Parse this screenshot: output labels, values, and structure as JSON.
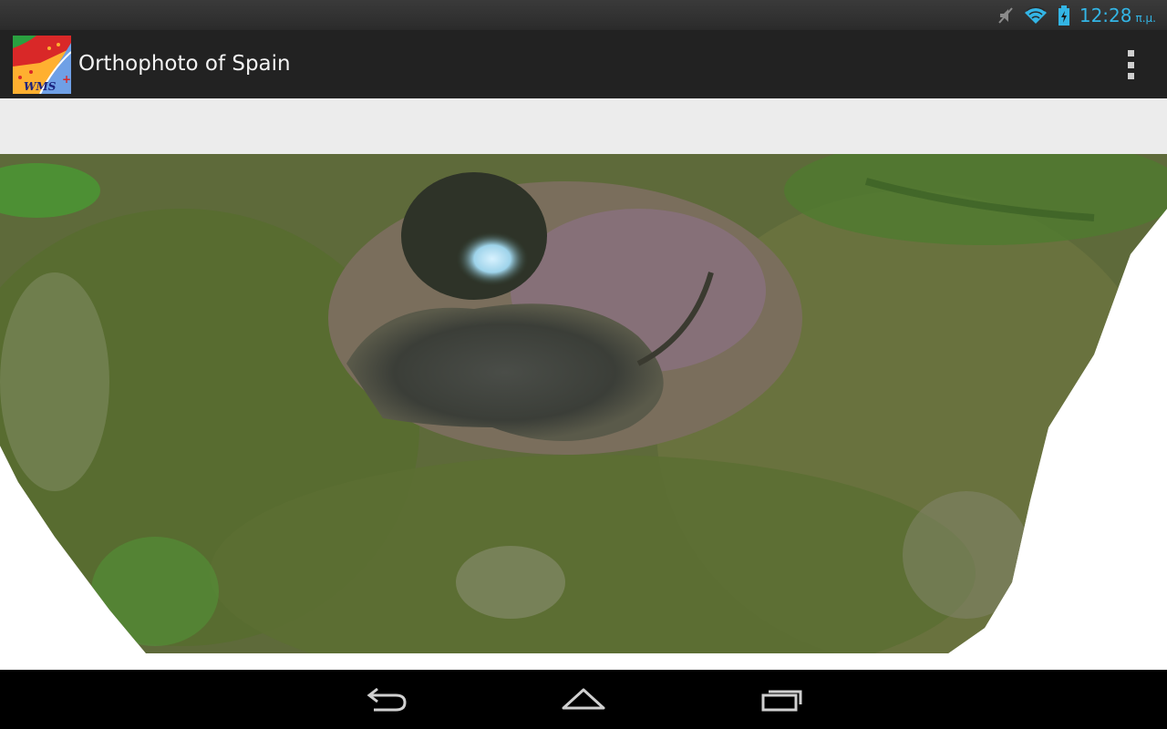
{
  "status_bar": {
    "icons": [
      "muted-icon",
      "wifi-icon",
      "battery-charging-icon"
    ],
    "time": "12:28",
    "ampm": "π.μ.",
    "accent_color": "#33b5e5"
  },
  "action_bar": {
    "app_icon_text": "WMS",
    "title": "Orthophoto of Spain",
    "overflow_icon": "overflow-menu-icon"
  },
  "map": {
    "content": "satellite-orthophoto"
  },
  "nav_bar": {
    "icons": [
      "back-icon",
      "home-icon",
      "recent-apps-icon"
    ]
  }
}
